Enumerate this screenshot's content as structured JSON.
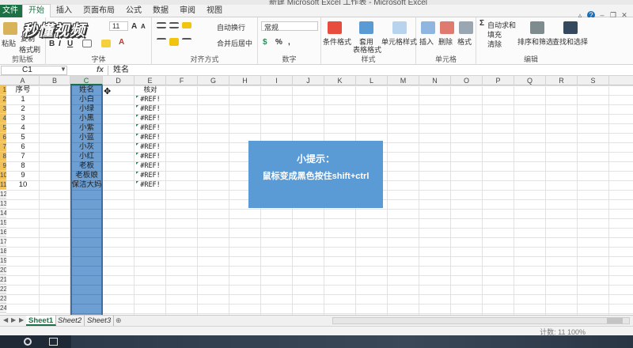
{
  "window": {
    "title": "新建 Microsoft Excel 工作表 - Microsoft Excel"
  },
  "tabs": [
    "文件",
    "开始",
    "插入",
    "页面布局",
    "公式",
    "数据",
    "审阅",
    "视图"
  ],
  "ribbon": {
    "clipboard": {
      "label": "剪贴板",
      "paste": "粘贴",
      "copy": "复制",
      "format_painter": "格式刷"
    },
    "font": {
      "label": "字体",
      "size": "11"
    },
    "alignment": {
      "label": "对齐方式",
      "wrap": "自动换行",
      "merge": "合并后居中"
    },
    "number": {
      "label": "数字",
      "format": "常规"
    },
    "styles": {
      "label": "样式",
      "conditional": "条件格式",
      "table_line1": "套用",
      "table_line2": "表格格式",
      "cell_styles": "单元格样式"
    },
    "cells": {
      "label": "单元格",
      "insert": "插入",
      "delete": "删除",
      "format": "格式"
    },
    "editing": {
      "label": "编辑",
      "autosum": "自动求和",
      "fill": "填充",
      "clear": "清除",
      "sort": "排序和筛选",
      "find": "查找和选择"
    }
  },
  "watermark": "秒懂视频",
  "formula_bar": {
    "name_box": "C1",
    "fx": "fx",
    "content": "姓名"
  },
  "columns": [
    "A",
    "B",
    "C",
    "D",
    "E",
    "F",
    "G",
    "H",
    "I",
    "J",
    "K",
    "L",
    "M",
    "N",
    "O",
    "P",
    "Q",
    "R",
    "S"
  ],
  "selected_column": "C",
  "rows": [
    "1",
    "2",
    "3",
    "4",
    "5",
    "6",
    "7",
    "8",
    "9",
    "10",
    "11",
    "12",
    "13",
    "14",
    "15",
    "16",
    "17",
    "18",
    "19",
    "20",
    "21",
    "22",
    "23",
    "24"
  ],
  "table": {
    "header": {
      "a": "序号",
      "c": "姓名",
      "e": "核对"
    },
    "records": [
      {
        "a": "1",
        "c": "小白",
        "e": "#REF!"
      },
      {
        "a": "2",
        "c": "小绿",
        "e": "#REF!"
      },
      {
        "a": "3",
        "c": "小黑",
        "e": "#REF!"
      },
      {
        "a": "4",
        "c": "小紫",
        "e": "#REF!"
      },
      {
        "a": "5",
        "c": "小蓝",
        "e": "#REF!"
      },
      {
        "a": "6",
        "c": "小灰",
        "e": "#REF!"
      },
      {
        "a": "7",
        "c": "小红",
        "e": "#REF!"
      },
      {
        "a": "8",
        "c": "老板",
        "e": "#REF!"
      },
      {
        "a": "9",
        "c": "老板娘",
        "e": "#REF!"
      },
      {
        "a": "10",
        "c": "保洁大妈",
        "e": "#REF!"
      }
    ]
  },
  "tip": {
    "title": "小提示：",
    "body": "鼠标变成黑色按住shift+ctrl"
  },
  "sheets": [
    "Sheet1",
    "Sheet2",
    "Sheet3"
  ],
  "active_sheet": "Sheet1",
  "status": {
    "right": "计数: 11    100%"
  },
  "colors": {
    "excel_green": "#1e7145",
    "selection_blue": "#6d9fd2",
    "tip_blue": "#5b9bd5",
    "row_highlight": "#f2c25a"
  }
}
